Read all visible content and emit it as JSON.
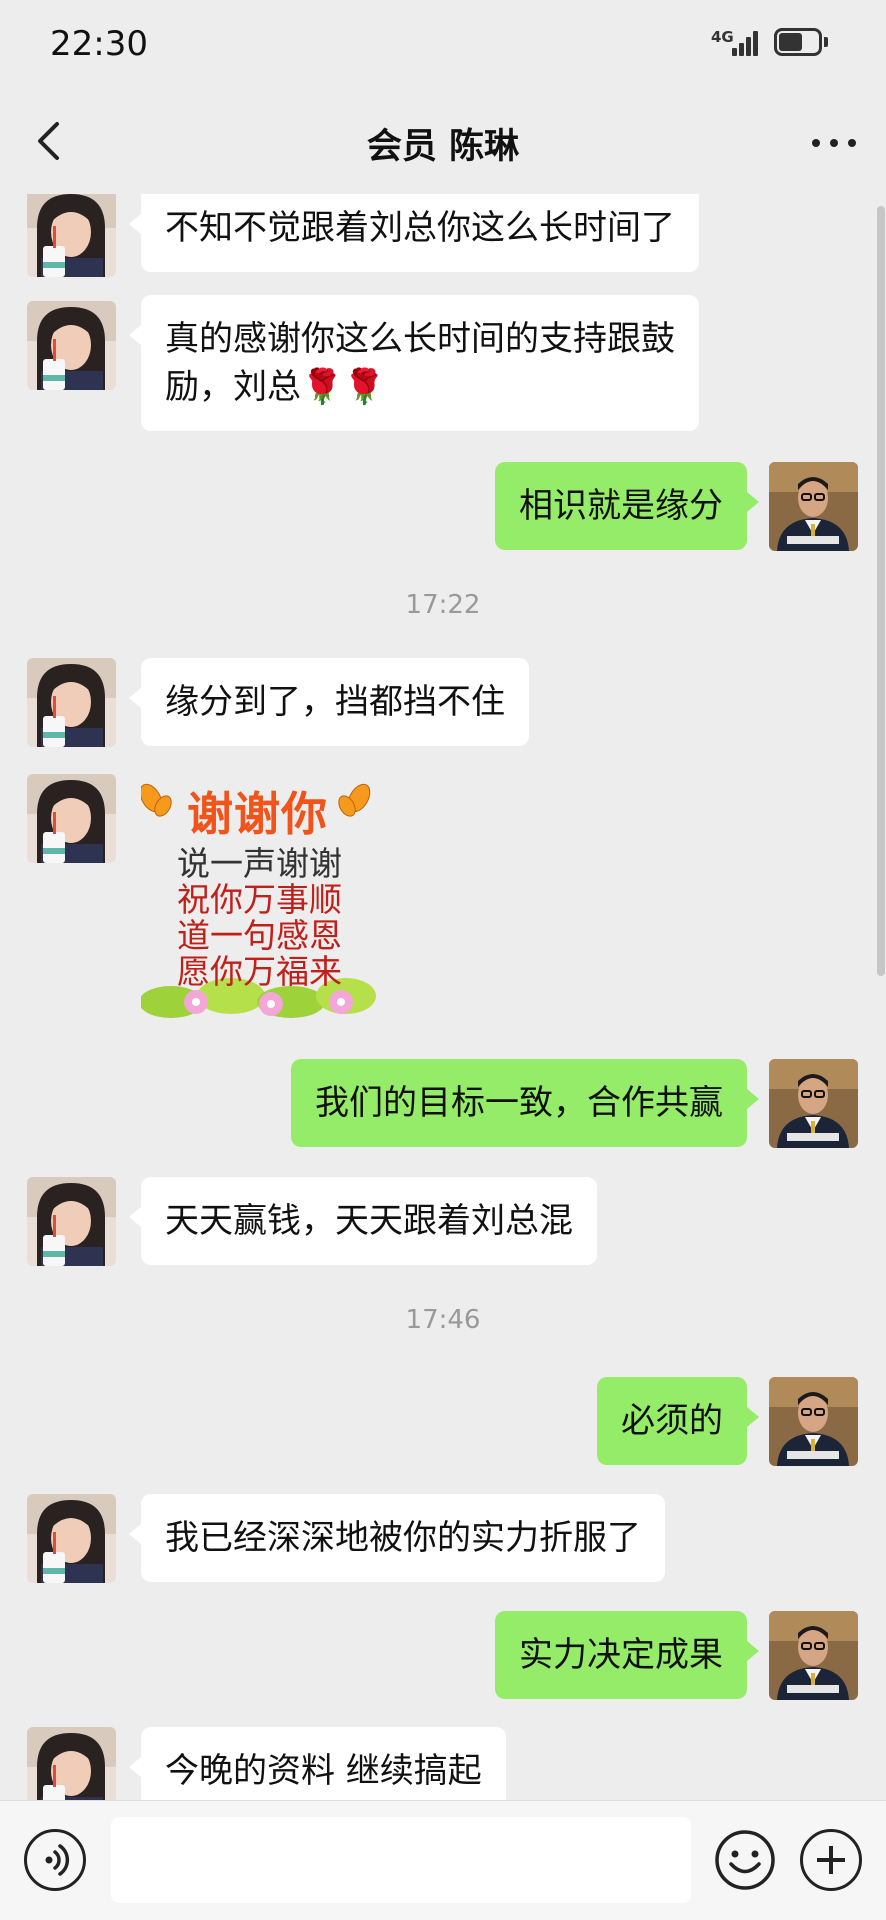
{
  "status_bar": {
    "time": "22:30",
    "network": "4G",
    "battery_level": 0.6
  },
  "header": {
    "title": "会员 陈琳",
    "back_icon": "chevron-left-icon",
    "more_icon": "more-dots-icon"
  },
  "messages": [
    {
      "from": "contact",
      "text": "不知不觉跟着刘总你这么长时间了"
    },
    {
      "from": "contact",
      "text": "真的感谢你这么长时间的支持跟鼓\n励，刘总🌹🌹"
    },
    {
      "from": "me",
      "text": "相识就是缘分"
    },
    {
      "timestamp": "17:22"
    },
    {
      "from": "contact",
      "text": "缘分到了，挡都挡不住"
    },
    {
      "from": "contact",
      "sticker": {
        "title": "谢谢你",
        "lines": [
          "说一声谢谢",
          "祝你万事顺",
          "道一句感恩",
          "愿你万福来"
        ]
      }
    },
    {
      "from": "me",
      "text": "我们的目标一致，合作共赢"
    },
    {
      "from": "contact",
      "text": "天天赢钱，天天跟着刘总混"
    },
    {
      "timestamp": "17:46"
    },
    {
      "from": "me",
      "text": "必须的"
    },
    {
      "from": "contact",
      "text": "我已经深深地被你的实力折服了"
    },
    {
      "from": "me",
      "text": "实力决定成果"
    },
    {
      "from": "contact",
      "text": "今晚的资料 继续搞起"
    }
  ],
  "input_bar": {
    "voice_icon": "voice-icon",
    "input_value": "",
    "emoji_icon": "emoji-icon",
    "plus_icon": "plus-icon"
  },
  "colors": {
    "background": "#ededed",
    "outgoing_bubble": "#95ec69",
    "incoming_bubble": "#ffffff"
  }
}
